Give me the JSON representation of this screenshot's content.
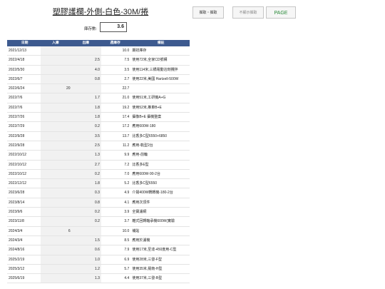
{
  "header": {
    "title": "塑膠護欄-外側-白色-30M/捲",
    "buttons": [
      "擷取・擷取",
      "不顯示擷取",
      "PAGE"
    ],
    "stock_label": "庫存數:",
    "stock_value": "3.6"
  },
  "table": {
    "columns": [
      "日期",
      "入庫",
      "出庫",
      "週庫存",
      "備註"
    ],
    "rows": [
      {
        "date": "2021/12/13",
        "in": "",
        "out": "",
        "balance": "10.0",
        "note": "期初庫存"
      },
      {
        "date": "2022/4/18",
        "in": "",
        "out": "2.5",
        "balance": "7.5",
        "note": "使用72米,全家CD號構"
      },
      {
        "date": "2022/5/30",
        "in": "",
        "out": "4.0",
        "balance": "3.5",
        "note": "使用114米,三橋電動溶劑攪拌"
      },
      {
        "date": "2022/6/7",
        "in": "",
        "out": "0.8",
        "balance": "2.7",
        "note": "使用22米,美國 Hartzell-500W"
      },
      {
        "date": "2022/6/24",
        "in": "20",
        "out": "",
        "balance": "22.7",
        "note": ""
      },
      {
        "date": "2022/7/6",
        "in": "",
        "out": "1.7",
        "balance": "21.0",
        "note": "使用51米,工研機A+G"
      },
      {
        "date": "2022/7/6",
        "in": "",
        "out": "1.8",
        "balance": "19.2",
        "note": "使用52米,推車B+E"
      },
      {
        "date": "2022/7/26",
        "in": "",
        "out": "1.8",
        "balance": "17.4",
        "note": "攝像B+E 攝機整案"
      },
      {
        "date": "2022/7/29",
        "in": "",
        "out": "0.2",
        "balance": "17.2",
        "note": "應用600W-180"
      },
      {
        "date": "2022/9/28",
        "in": "",
        "out": "3.5",
        "balance": "13.7",
        "note": "比香多C型6550+6850"
      },
      {
        "date": "2022/9/28",
        "in": "",
        "out": "2.5",
        "balance": "11.2",
        "note": "應用-軌型2台"
      },
      {
        "date": "2022/10/12",
        "in": "",
        "out": "1.3",
        "balance": "9.9",
        "note": "應用-前輪"
      },
      {
        "date": "2022/10/12",
        "in": "",
        "out": "2.7",
        "balance": "7.2",
        "note": "比香多E型"
      },
      {
        "date": "2022/10/12",
        "in": "",
        "out": "0.2",
        "balance": "7.0",
        "note": "應用600W-90-2台"
      },
      {
        "date": "2022/12/12",
        "in": "",
        "out": "1.8",
        "balance": "5.2",
        "note": "比香多C型6550"
      },
      {
        "date": "2023/6/28",
        "in": "",
        "out": "0.3",
        "balance": "4.9",
        "note": "介揚400W轉轉機-180-2台"
      },
      {
        "date": "2023/8/14",
        "in": "",
        "out": "0.8",
        "balance": "4.1",
        "note": "應用次頂件"
      },
      {
        "date": "2023/9/6",
        "in": "",
        "out": "0.2",
        "balance": "3.9",
        "note": "全寶濾網"
      },
      {
        "date": "2023/11/8",
        "in": "",
        "out": "0.2",
        "balance": "3.7",
        "note": "離式回轉軸承機600W(實驗"
      },
      {
        "date": "2024/3/4",
        "in": "6",
        "out": "",
        "balance": "10.0",
        "note": "補貼"
      },
      {
        "date": "2024/3/4",
        "in": "",
        "out": "1.5",
        "balance": "8.5",
        "note": "應用於濾機"
      },
      {
        "date": "2024/8/16",
        "in": "",
        "out": "0.6",
        "balance": "7.9",
        "note": "使用17米,至達-450度用-C型"
      },
      {
        "date": "2025/2/19",
        "in": "",
        "out": "1.0",
        "balance": "6.9",
        "note": "使用28米,三發-F型"
      },
      {
        "date": "2025/3/12",
        "in": "",
        "out": "1.2",
        "balance": "5.7",
        "note": "使用35米,揚南-H型"
      },
      {
        "date": "2025/6/19",
        "in": "",
        "out": "1.3",
        "balance": "4.4",
        "note": "使用37米,三發-B型"
      }
    ]
  }
}
